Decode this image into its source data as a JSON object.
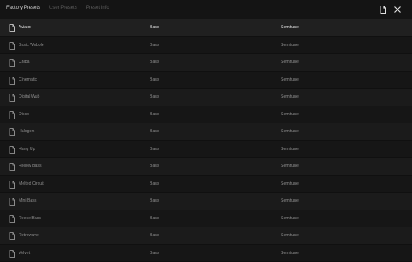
{
  "tabs": [
    {
      "label": "Factory Presets",
      "active": true
    },
    {
      "label": "User Presets",
      "active": false
    },
    {
      "label": "Preset Info",
      "active": false
    }
  ],
  "toolbar": {
    "new_preset_icon": "file-icon",
    "close_icon": "close-icon"
  },
  "presets": [
    {
      "name": "Aviator",
      "category": "Bass",
      "author": "Semitune",
      "selected": true
    },
    {
      "name": "Basic Wubble",
      "category": "Bass",
      "author": "Semitune"
    },
    {
      "name": "Chiba",
      "category": "Bass",
      "author": "Semitune"
    },
    {
      "name": "Cinematic",
      "category": "Bass",
      "author": "Semitune"
    },
    {
      "name": "Digital Wub",
      "category": "Bass",
      "author": "Semitune"
    },
    {
      "name": "Disco",
      "category": "Bass",
      "author": "Semitune"
    },
    {
      "name": "Halogen",
      "category": "Bass",
      "author": "Semitune"
    },
    {
      "name": "Hang Up",
      "category": "Bass",
      "author": "Semitune"
    },
    {
      "name": "Hollow Bass",
      "category": "Bass",
      "author": "Semitune"
    },
    {
      "name": "Melted Circuit",
      "category": "Bass",
      "author": "Semitune"
    },
    {
      "name": "Mini Bass",
      "category": "Bass",
      "author": "Semitune"
    },
    {
      "name": "Reese Bass",
      "category": "Bass",
      "author": "Semitune"
    },
    {
      "name": "Retrowave",
      "category": "Bass",
      "author": "Semitune"
    },
    {
      "name": "Velvet",
      "category": "Bass",
      "author": "Semitune"
    }
  ],
  "colors": {
    "background": "#141414",
    "row_odd": "#1b1b1b",
    "row_even": "#161616",
    "text": "#8c8c8c",
    "text_selected": "#e2e2e2"
  }
}
